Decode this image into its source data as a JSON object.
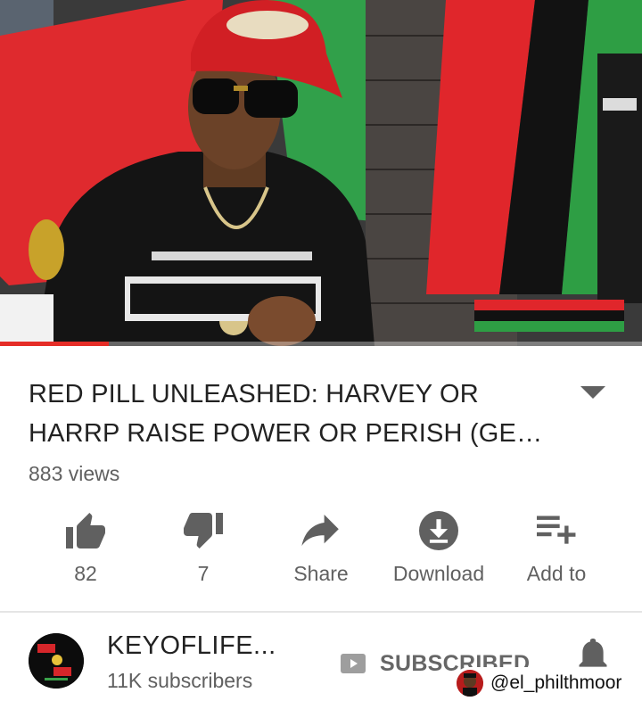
{
  "video": {
    "progress_fraction": 0.17,
    "colors": {
      "red": "#e0262b",
      "green": "#2e9e44",
      "black": "#111111",
      "progress": "#e52d27"
    }
  },
  "title": {
    "text": "RED PILL UNLEASHED: HARVEY OR HARRP RAISE POWER OR PERISH (GE…",
    "views": "883 views",
    "expand_icon": "caret-down-icon"
  },
  "actions": [
    {
      "icon": "thumbs-up-icon",
      "label": "82"
    },
    {
      "icon": "thumbs-down-icon",
      "label": "7"
    },
    {
      "icon": "share-icon",
      "label": "Share"
    },
    {
      "icon": "download-icon",
      "label": "Download"
    },
    {
      "icon": "playlist-add-icon",
      "label": "Add to"
    }
  ],
  "channel": {
    "name": "KEYOFLIFE...",
    "subscribers": "11K subscribers",
    "subscribe_label": "SUBSCRIBED",
    "bell_icon": "bell-icon"
  },
  "watermark": {
    "handle": "@el_philthmoor"
  }
}
